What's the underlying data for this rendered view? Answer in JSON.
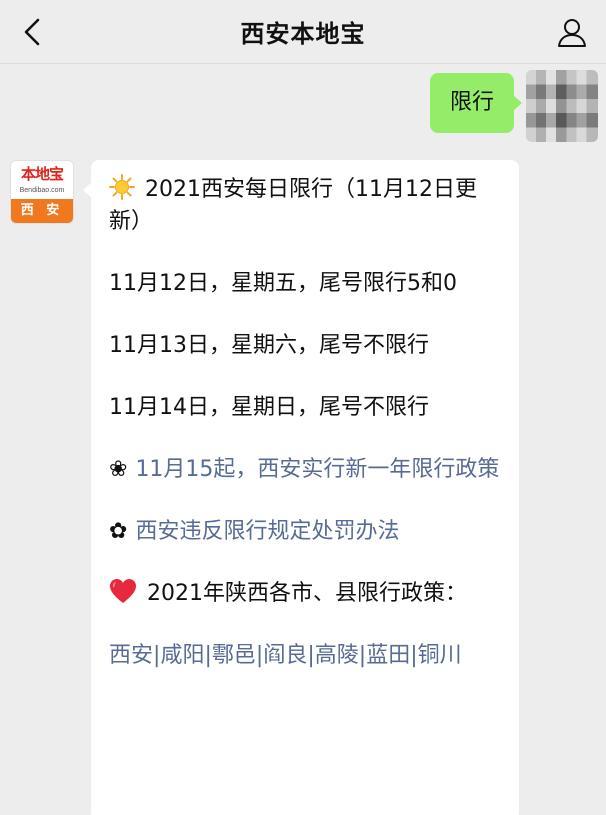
{
  "header": {
    "title": "西安本地宝",
    "back_icon": "chevron-left-icon",
    "profile_icon": "person-icon"
  },
  "outgoing": {
    "text": "限行",
    "bubble_color": "#95ec69"
  },
  "bot": {
    "avatar": {
      "logo_text": "本地宝",
      "logo_subtext": "Bendibao.com",
      "city_label": "西 安"
    },
    "message": {
      "line1_icon": "sun-icon",
      "line1": "2021西安每日限行（11月12日更新）",
      "line2": "11月12日，星期五，尾号限行5和0",
      "line3": "11月13日，星期六，尾号不限行",
      "line4": "11月14日，星期日，尾号不限行",
      "link1_icon": "❀",
      "link1": "11月15起，西安实行新一年限行政策",
      "link2_icon": "✿",
      "link2": "西安违反限行规定处罚办法",
      "line7_icon": "heart-icon",
      "line7": "2021年陕西各市、县限行政策：",
      "cities": [
        "西安",
        "咸阳",
        "鄠邑",
        "阎良",
        "高陵",
        "蓝田",
        "铜川"
      ],
      "link_color": "#576b95"
    }
  }
}
